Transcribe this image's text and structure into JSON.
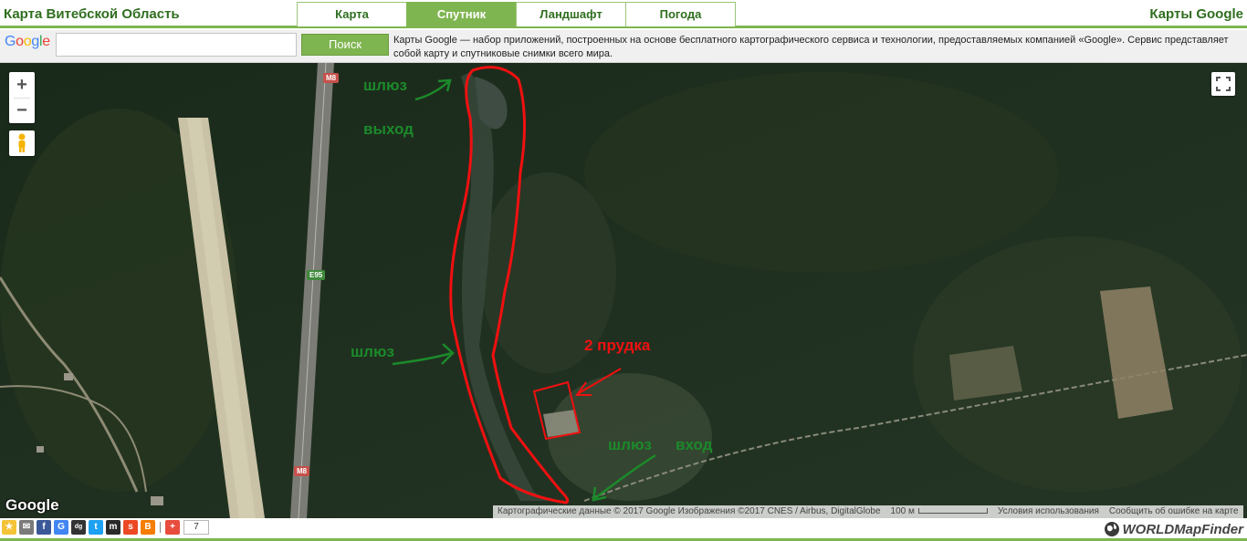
{
  "header": {
    "site_title": "Карта Витебской Область",
    "brand_right": "Карты Google",
    "tabs": [
      {
        "label": "Карта",
        "active": false
      },
      {
        "label": "Спутник",
        "active": true
      },
      {
        "label": "Ландшафт",
        "active": false
      },
      {
        "label": "Погода",
        "active": false
      }
    ]
  },
  "search": {
    "logo": "Google",
    "value": "",
    "button_label": "Поиск",
    "description": "Карты Google — набор приложений, построенных на основе бесплатного картографического сервиса и технологии, предоставляемых компанией «Google». Сервис представляет собой карту и спутниковые снимки всего мира."
  },
  "map": {
    "controls": {
      "zoom_in": "+",
      "zoom_out": "−",
      "pegman_icon": "pegman-icon",
      "fullscreen_icon": "fullscreen-icon"
    },
    "road_labels": {
      "m8_top": "M8",
      "e95": "E95",
      "m8_bottom": "M8"
    },
    "annotations": {
      "sluice_top": "шлюз",
      "exit": "выход",
      "sluice_middle": "шлюз",
      "two_ponds": "2 прудка",
      "sluice_bottom": "шлюз",
      "entrance": "вход"
    },
    "google_logo": "Google",
    "attribution": {
      "copyright": "Картографические данные © 2017 Google Изображения ©2017 CNES / Airbus, DigitalGlobe",
      "scale": "100 м",
      "terms": "Условия использования",
      "report": "Сообщить об ошибке на карте"
    }
  },
  "footer": {
    "share_icons": [
      "star-icon",
      "email-icon",
      "facebook-icon",
      "google-icon",
      "digg-icon",
      "twitter-icon",
      "myspace-icon",
      "stumbleupon-icon",
      "blogger-icon"
    ],
    "share_count": "7",
    "logo": "WORLDMapFinder"
  },
  "colors": {
    "accent_green": "#7fb550",
    "annotation_green": "#1b8a2a",
    "annotation_red": "#f01010"
  }
}
